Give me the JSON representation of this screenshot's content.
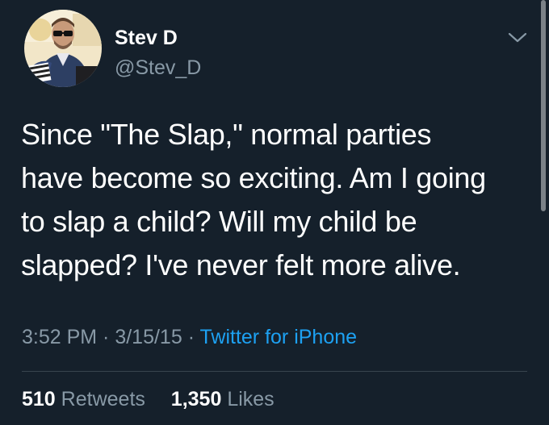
{
  "user": {
    "display_name": "Stev D",
    "handle": "@Stev_D"
  },
  "tweet": {
    "text": "Since \"The Slap,\" normal parties\nhave become so exciting. Am I going\nto slap a child? Will my child be\nslapped? I've never felt more alive.",
    "time": "3:52 PM",
    "separator": " · ",
    "date": "3/15/15",
    "source": "Twitter for iPhone"
  },
  "stats": {
    "retweets_count": "510",
    "retweets_label": "Retweets",
    "likes_count": "1,350",
    "likes_label": "Likes"
  },
  "icons": {
    "menu": "chevron-down-icon"
  },
  "colors": {
    "background": "#15202b",
    "text": "#ffffff",
    "secondary": "#8899a6",
    "link": "#1da1f2",
    "divider": "#38444d"
  }
}
